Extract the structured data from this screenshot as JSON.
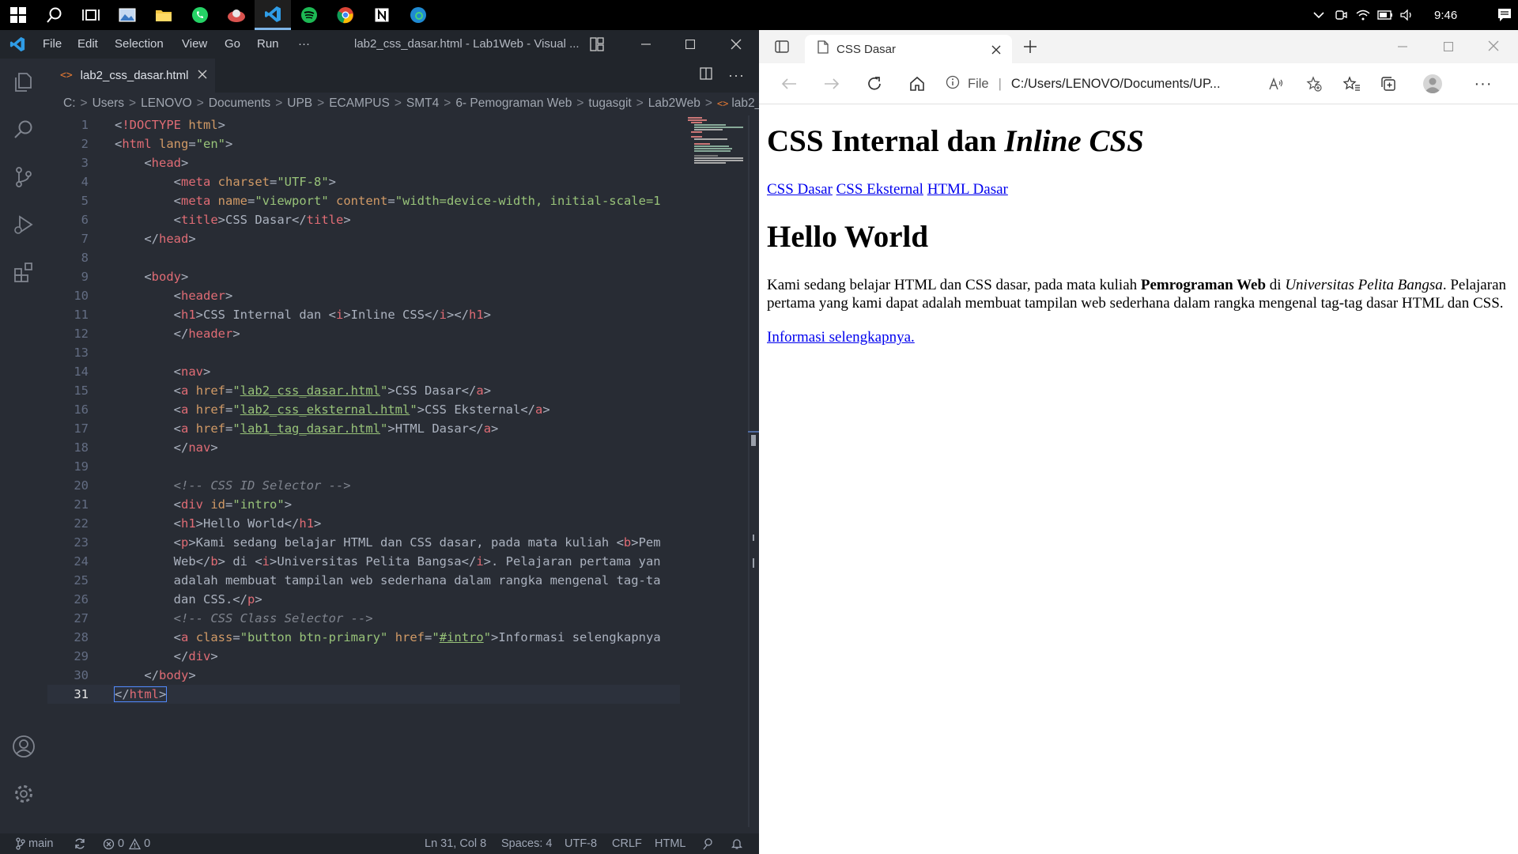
{
  "taskbar": {
    "time": "9:46"
  },
  "vscode": {
    "menu": [
      "File",
      "Edit",
      "Selection",
      "View",
      "Go",
      "Run",
      "···"
    ],
    "window_title": "lab2_css_dasar.html - Lab1Web - Visual ...",
    "tab_label": "lab2_css_dasar.html",
    "breadcrumb": [
      "C:",
      "Users",
      "LENOVO",
      "Documents",
      "UPB",
      "ECAMPUS",
      "SMT4",
      "6- Pemograman Web",
      "tugasgit",
      "Lab2Web",
      "lab2_"
    ],
    "status": {
      "branch": "main",
      "errors": "0",
      "warnings": "0",
      "position": "Ln 31, Col 8",
      "spaces": "Spaces: 4",
      "encoding": "UTF-8",
      "eol": "CRLF",
      "language": "HTML"
    },
    "line_numbers": [
      "1",
      "2",
      "3",
      "4",
      "5",
      "6",
      "7",
      "8",
      "9",
      "10",
      "11",
      "12",
      "13",
      "14",
      "15",
      "16",
      "17",
      "18",
      "19",
      "20",
      "21",
      "22",
      "23",
      "24",
      "25",
      "26",
      "27",
      "28",
      "29",
      "30",
      "31"
    ]
  },
  "browser": {
    "tab_title": "CSS Dasar",
    "address_scheme": "File",
    "address_url": "C:/Users/LENOVO/Documents/UP...",
    "page": {
      "h1_text": "CSS Internal dan ",
      "h1_italic": "Inline CSS",
      "nav": [
        "CSS Dasar",
        "CSS Eksternal",
        "HTML Dasar"
      ],
      "h2": "Hello World",
      "p_part1": "Kami sedang belajar HTML dan CSS dasar, pada mata kuliah ",
      "p_bold": "Pemrograman Web",
      "p_part2": " di ",
      "p_italic": "Universitas Pelita Bangsa",
      "p_part3": ". Pelajaran pertama yang kami dapat adalah membuat tampilan web sederhana dalam rangka mengenal tag-tag dasar HTML dan CSS.",
      "more_link": "Informasi selengkapnya."
    }
  }
}
